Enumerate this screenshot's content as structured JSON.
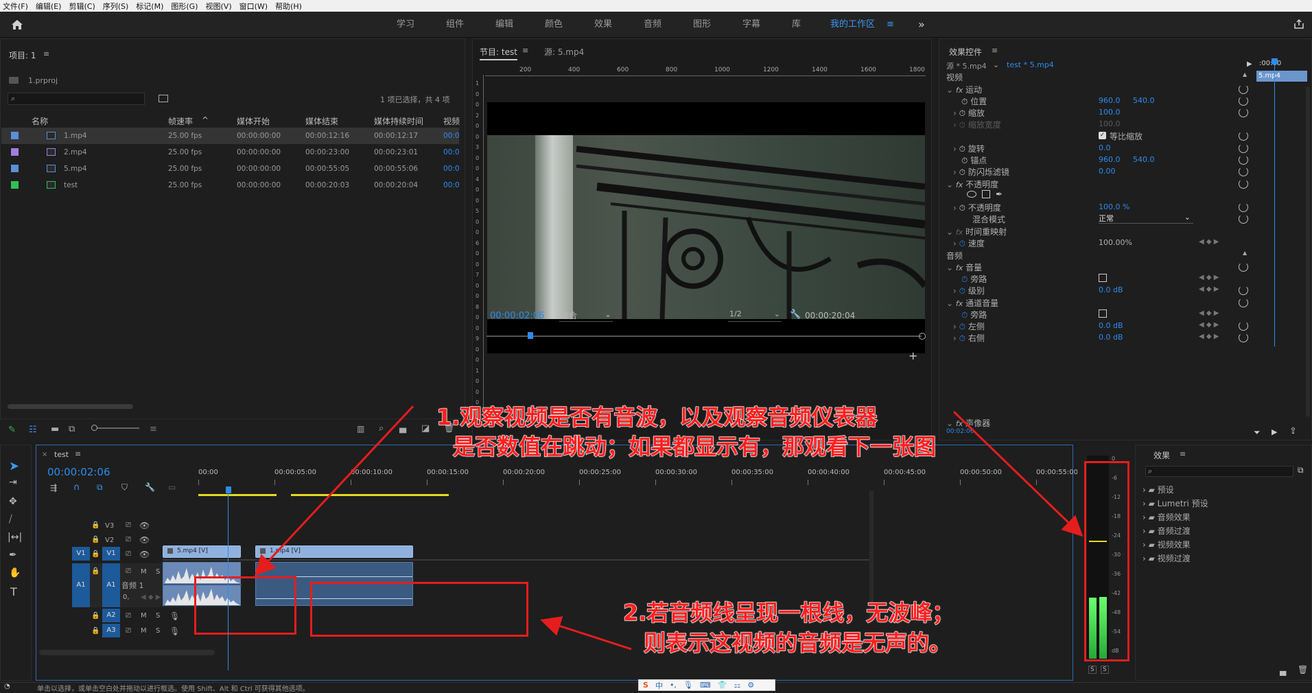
{
  "menu": [
    "文件(F)",
    "编辑(E)",
    "剪辑(C)",
    "序列(S)",
    "标记(M)",
    "图形(G)",
    "视图(V)",
    "窗口(W)",
    "帮助(H)"
  ],
  "workspaces": [
    "学习",
    "组件",
    "编辑",
    "颜色",
    "效果",
    "音频",
    "图形",
    "字幕",
    "库",
    "我的工作区"
  ],
  "workspace_overflow": "»",
  "project": {
    "title": "项目: 1",
    "file": "1.prproj",
    "selection_info": "1 项已选择，共 4 项",
    "columns": [
      "名称",
      "帧速率",
      "媒体开始",
      "媒体结束",
      "媒体持续时间",
      "视频"
    ],
    "items": [
      {
        "name": "1.mp4",
        "fps": "25.00 fps",
        "start": "00:00:00:00",
        "end": "00:00:12:16",
        "dur": "00:00:12:17",
        "v": "00:0",
        "color": "#5b8fd6"
      },
      {
        "name": "2.mp4",
        "fps": "25.00 fps",
        "start": "00:00:00:00",
        "end": "00:00:23:00",
        "dur": "00:00:23:01",
        "v": "00:0",
        "color": "#a27ee0"
      },
      {
        "name": "5.mp4",
        "fps": "25.00 fps",
        "start": "00:00:00:00",
        "end": "00:00:55:05",
        "dur": "00:00:55:06",
        "v": "00:0",
        "color": "#5b8fd6"
      },
      {
        "name": "test",
        "fps": "25.00 fps",
        "start": "00:00:00:00",
        "end": "00:00:20:03",
        "dur": "00:00:20:04",
        "v": "00:0",
        "color": "#2fbf5a"
      }
    ]
  },
  "program": {
    "tab_program": "节目: test",
    "tab_source": "源: 5.mp4",
    "ruler": [
      "200",
      "400",
      "600",
      "800",
      "1000",
      "1200",
      "1400",
      "1600",
      "1800"
    ],
    "vruler": [
      "1",
      "0",
      "0",
      "2",
      "0",
      "0",
      "3",
      "0",
      "0",
      "4",
      "0",
      "0",
      "5",
      "0",
      "0",
      "6",
      "0",
      "0",
      "7",
      "0",
      "0",
      "8",
      "0",
      "0",
      "9",
      "0",
      "0",
      "1",
      "0",
      "0",
      "0"
    ],
    "timecode": "00:00:02:06",
    "fit": "适合",
    "res": "1/2",
    "duration": "00:00:20:04"
  },
  "effect_controls": {
    "title": "效果控件",
    "source": "源 * 5.mp4",
    "seq": "test * 5.mp4",
    "clip_label": "5.mp4",
    "mini_time": ":00:00",
    "foot_time": "00:02:06",
    "video": "视频",
    "motion": "运动",
    "position": "位置",
    "pos_x": "960.0",
    "pos_y": "540.0",
    "scale": "缩放",
    "scale_v": "100.0",
    "scale_w": "缩放宽度",
    "scale_w_v": "100.0",
    "uniform": "等比缩放",
    "rotation": "旋转",
    "rotation_v": "0.0",
    "anchor": "锚点",
    "anchor_x": "960.0",
    "anchor_y": "540.0",
    "flicker": "防闪烁滤镜",
    "flicker_v": "0.00",
    "opacity": "不透明度",
    "opacity_p": "不透明度",
    "opacity_v": "100.0 %",
    "blend": "混合模式",
    "blend_v": "正常",
    "time_remap": "时间重映射",
    "speed": "速度",
    "speed_v": "100.00%",
    "audio": "音频",
    "volume": "音量",
    "bypass": "旁路",
    "level": "级别",
    "level_v": "0.0 dB",
    "channel_volume": "通道音量",
    "bypass2": "旁路",
    "left": "左侧",
    "left_v": "0.0 dB",
    "right": "右侧",
    "right_v": "0.0 dB",
    "panner": "声像器"
  },
  "timeline": {
    "tab": "test",
    "timecode": "00:00:02:06",
    "ruler": [
      "00:00",
      "00:00:05:00",
      "00:00:10:00",
      "00:00:15:00",
      "00:00:20:00",
      "00:00:25:00",
      "00:00:30:00",
      "00:00:35:00",
      "00:00:40:00",
      "00:00:45:00",
      "00:00:50:00",
      "00:00:55:00"
    ],
    "tracks_v": [
      "V3",
      "V2",
      "V1"
    ],
    "tracks_a": [
      "A1",
      "A2",
      "A3"
    ],
    "src_v": "V1",
    "src_a": "A1",
    "audio_track_name": "音频 1",
    "clip_v1a": "5.mp4 [V]",
    "clip_v1b": "1.mp4 [V]",
    "m": "M",
    "s": "S",
    "zero": "0,"
  },
  "meter": {
    "scale": [
      "0",
      "-6",
      "-12",
      "-18",
      "-24",
      "-30",
      "-36",
      "-42",
      "-48",
      "-54",
      "dB"
    ],
    "left_level": 0.66,
    "right_level": 0.67,
    "solo_l": "S",
    "solo_r": "S"
  },
  "effects": {
    "title": "效果",
    "items": [
      "预设",
      "Lumetri 预设",
      "音频效果",
      "音频过渡",
      "视频效果",
      "视频过渡"
    ]
  },
  "annotations": {
    "a1_line1": "1.观察视频是否有音波，以及观察音频仪表器",
    "a1_line2": "是否数值在跳动；如果都显示有，那观看下一张图",
    "a2_line1": "2.若音频线呈现一根线，无波峰；",
    "a2_line2": "则表示这视频的音频是无声的。"
  },
  "status": "单击以选择，或单击空白处并拖动以进行框选。使用 Shift、Alt 和 Ctrl 可获得其他选项。",
  "colors": {
    "accent": "#2d8ceb",
    "annotation": "#e61d1d",
    "meter": "#2fbf4a"
  }
}
